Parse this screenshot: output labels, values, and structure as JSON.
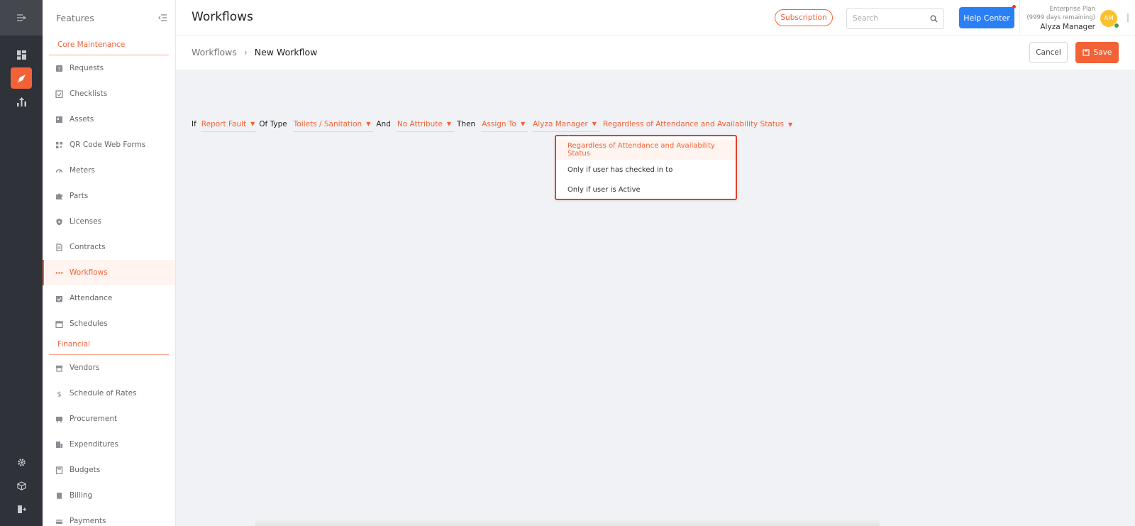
{
  "app": {
    "page_title": "Workflows",
    "accent": "#f26237"
  },
  "rail": {
    "items": [
      "menu-toggle-icon",
      "dashboard-icon",
      "rocket-icon",
      "reports-icon",
      "settings-icon",
      "cube-icon",
      "logout-icon"
    ]
  },
  "sidebar": {
    "title": "Features",
    "sections": [
      {
        "label": "Core Maintenance",
        "items": [
          {
            "label": "Requests",
            "icon": "request-icon"
          },
          {
            "label": "Checklists",
            "icon": "checklist-icon"
          },
          {
            "label": "Assets",
            "icon": "assets-icon"
          },
          {
            "label": "QR Code Web Forms",
            "icon": "qr-code-icon"
          },
          {
            "label": "Meters",
            "icon": "meter-icon"
          },
          {
            "label": "Parts",
            "icon": "puzzle-icon"
          },
          {
            "label": "Licenses",
            "icon": "shield-icon"
          },
          {
            "label": "Contracts",
            "icon": "contract-icon"
          },
          {
            "label": "Workflows",
            "icon": "workflow-icon",
            "active": true
          },
          {
            "label": "Attendance",
            "icon": "attendance-icon"
          },
          {
            "label": "Schedules",
            "icon": "calendar-icon"
          }
        ]
      },
      {
        "label": "Financial",
        "items": [
          {
            "label": "Vendors",
            "icon": "store-icon"
          },
          {
            "label": "Schedule of Rates",
            "icon": "dollar-icon"
          },
          {
            "label": "Procurement",
            "icon": "truck-icon"
          },
          {
            "label": "Expenditures",
            "icon": "expenditure-icon"
          },
          {
            "label": "Budgets",
            "icon": "calculator-icon"
          },
          {
            "label": "Billing",
            "icon": "billing-icon"
          },
          {
            "label": "Payments",
            "icon": "payment-icon"
          }
        ]
      }
    ]
  },
  "header": {
    "subscription_label": "Subscription",
    "search_placeholder": "Search",
    "help_label": "Help Center",
    "plan_name": "Enterprise Plan",
    "plan_remaining": "(9999 days remaining)",
    "user_name": "Alyza Manager",
    "avatar_initials": "AM"
  },
  "subheader": {
    "breadcrumb_parent": "Workflows",
    "breadcrumb_current": "New Workflow",
    "cancel_label": "Cancel",
    "save_label": "Save"
  },
  "rule": {
    "if_label": "If",
    "trigger": "Report Fault",
    "of_type_label": "Of Type",
    "type_value": "Toilets / Sanitation",
    "and_label": "And",
    "attribute_value": "No Attribute",
    "then_label": "Then",
    "action_value": "Assign To",
    "assignee_value": "Alyza Manager",
    "condition_value": "Regardless of Attendance and Availability Status"
  },
  "condition_menu": {
    "options": [
      "Regardless of Attendance and Availability Status",
      "Only if user has checked in to",
      "Only if user is Active"
    ],
    "selected_index": 0
  }
}
